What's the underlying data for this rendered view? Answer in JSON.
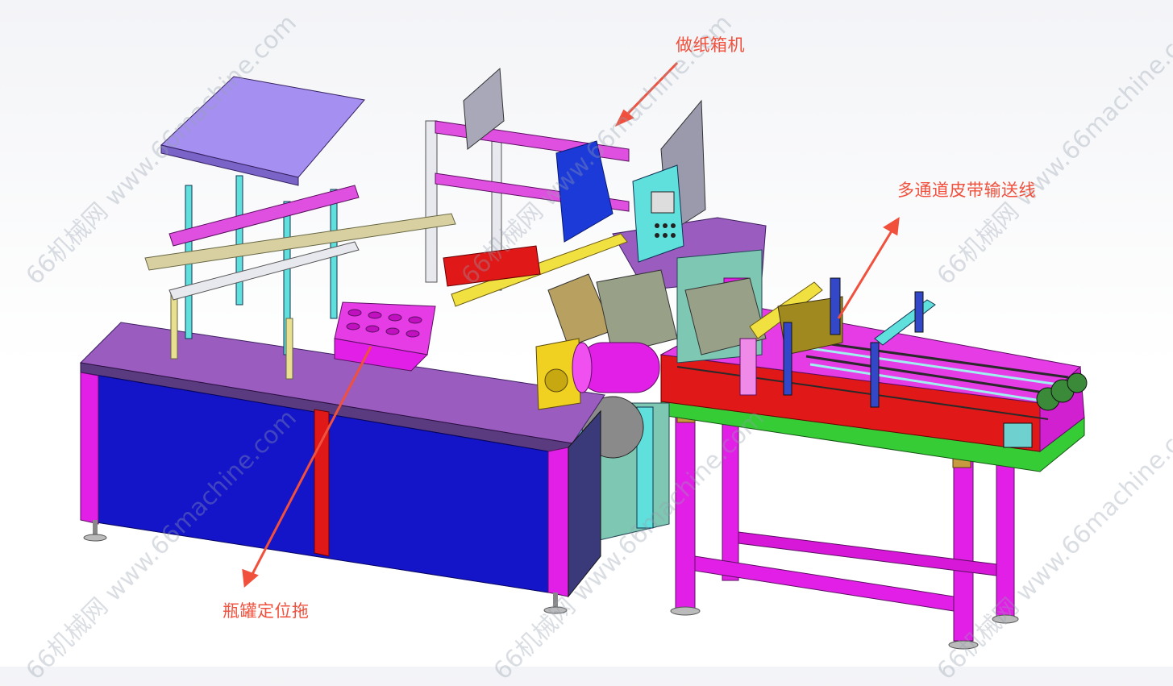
{
  "labels": {
    "carton_machine": "做纸箱机",
    "belt_conveyor": "多通道皮带输送线",
    "bottle_tray": "瓶罐定位拖"
  },
  "watermark": {
    "text": "66机械网 www.66machine.com"
  },
  "colors": {
    "callout": "#f0503c",
    "magenta": "#e61fe6",
    "purple": "#9a5cbf",
    "blue": "#1414c8",
    "red": "#e01818",
    "green": "#3cd13c",
    "cyan": "#5fe0dc",
    "yellow": "#f0e040",
    "lavender": "#a58ff0"
  }
}
